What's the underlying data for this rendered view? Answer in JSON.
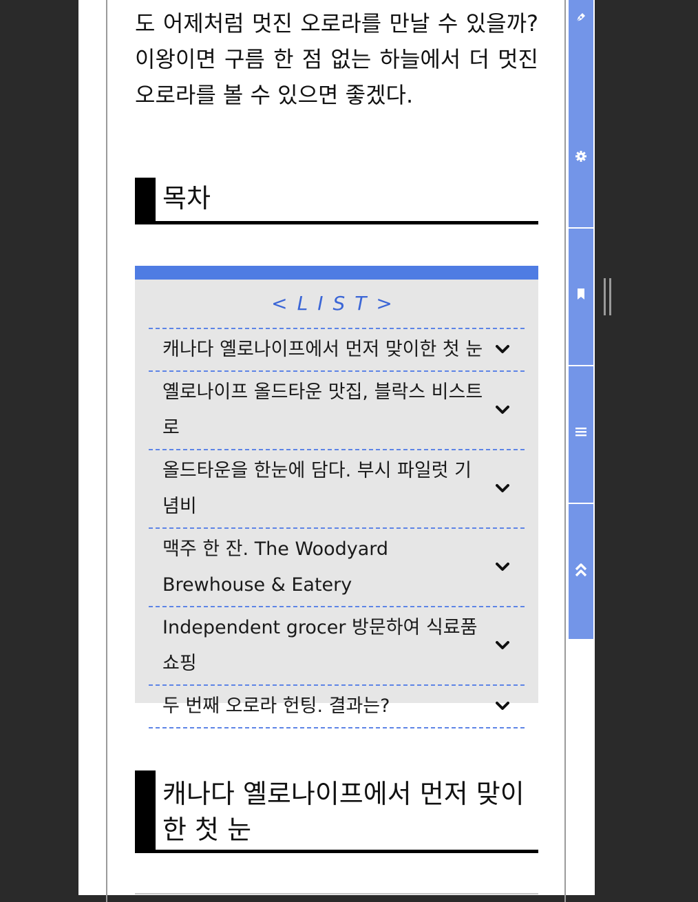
{
  "article": {
    "intro_text": "도 어제처럼 멋진 오로라를 만날 수 있을까? 이왕이면 구름 한 점 없는 하늘에서 더 멋진 오로라를 볼 수 있으면 좋겠다.",
    "toc_heading": "목차",
    "section_heading": "캐나다 옐로나이프에서 먼저 맞이한 첫 눈"
  },
  "toc": {
    "title": "<LIST>",
    "items": [
      {
        "label": "캐나다 옐로나이프에서 먼저 맞이한 첫 눈"
      },
      {
        "label": "옐로나이프 올드타운 맛집, 블락스 비스트로"
      },
      {
        "label": "올드타운을 한눈에 담다. 부시 파일럿 기념비"
      },
      {
        "label": "맥주 한 잔. The Woodyard Brewhouse & Eatery"
      },
      {
        "label": "Independent grocer 방문하여 식료품 쇼핑"
      },
      {
        "label": "두 번째 오로라 헌팅. 결과는?"
      }
    ]
  },
  "sidebar": {
    "buttons": [
      {
        "icon": "pen-icon"
      },
      {
        "icon": "gear-icon"
      },
      {
        "icon": "bookmark-icon"
      },
      {
        "icon": "menu-icon"
      },
      {
        "icon": "double-chevron-up-icon"
      }
    ]
  },
  "colors": {
    "accent": "#4f7ce3",
    "sidebar": "#7395e8",
    "toc_background": "#e6e6e6",
    "heading_bar": "#000000",
    "outer_background": "#2a2a2a"
  }
}
